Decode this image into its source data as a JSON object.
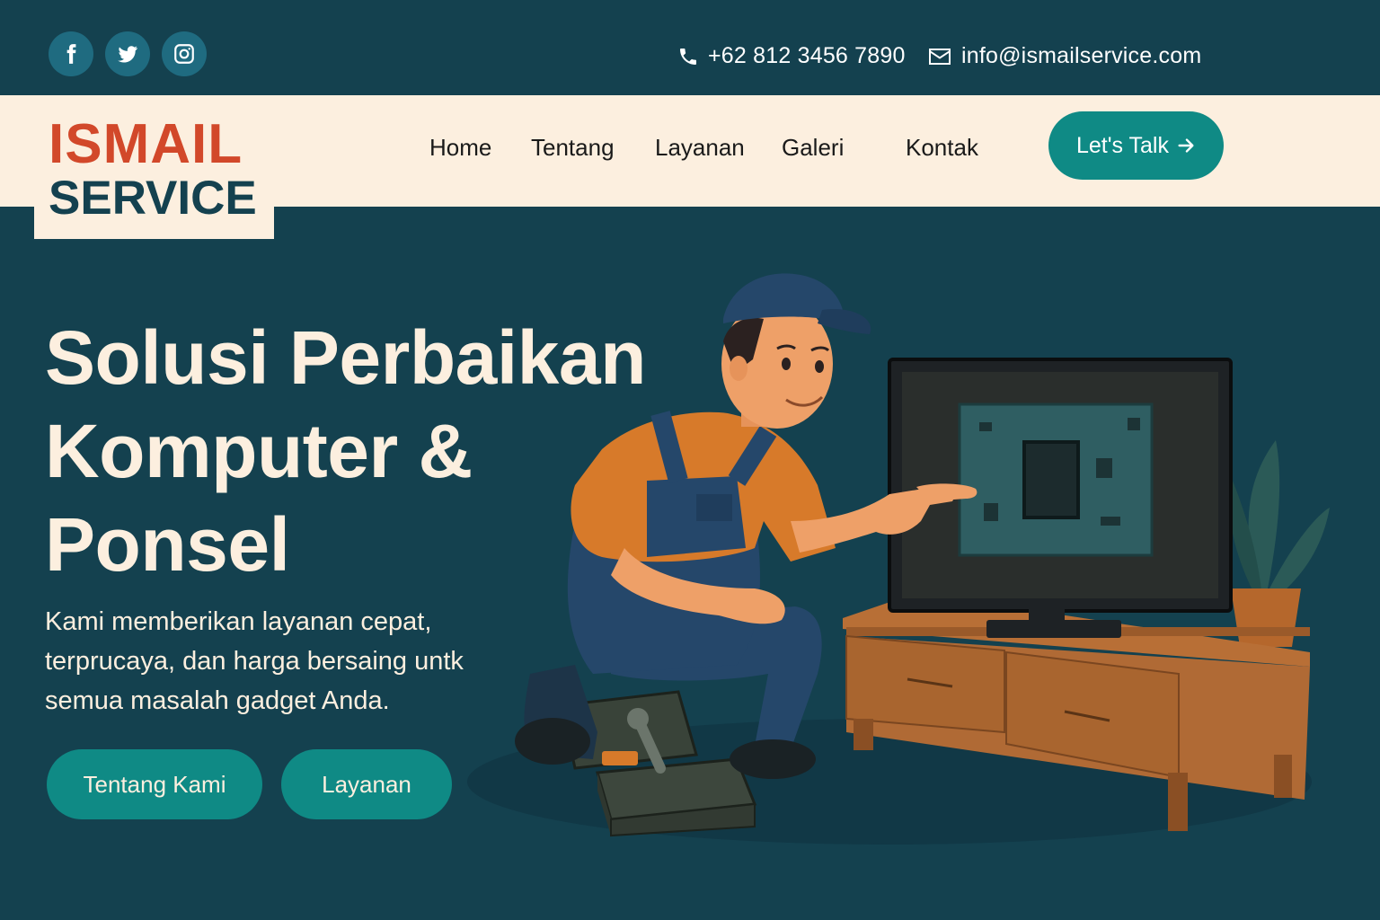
{
  "topbar": {
    "social": [
      {
        "icon": "facebook-icon"
      },
      {
        "icon": "twitter-icon"
      },
      {
        "icon": "instagram-icon"
      }
    ],
    "phone": "+62 812 3456 7890",
    "email": "info@ismailservice.com"
  },
  "logo": {
    "line1": "ISMAIL",
    "line2": "SERVICE"
  },
  "nav": {
    "items": [
      "Home",
      "Tentang",
      "Layanan",
      "Galeri",
      "Kontak"
    ],
    "cta": "Let's Talk"
  },
  "hero": {
    "title_lines": [
      "Solusi Perbaikan",
      "Komputer &",
      "Ponsel"
    ],
    "subtitle_lines": [
      "Kami memberikan layanan cepat,",
      "terprucaya, dan harga bersaing untk",
      "semua masalah gadget Anda."
    ],
    "buttons": [
      "Tentang Kami",
      "Layanan"
    ]
  },
  "colors": {
    "background": "#14414f",
    "cream": "#fcefdf",
    "accent": "#0f8a85",
    "logo_red": "#d2482a"
  }
}
